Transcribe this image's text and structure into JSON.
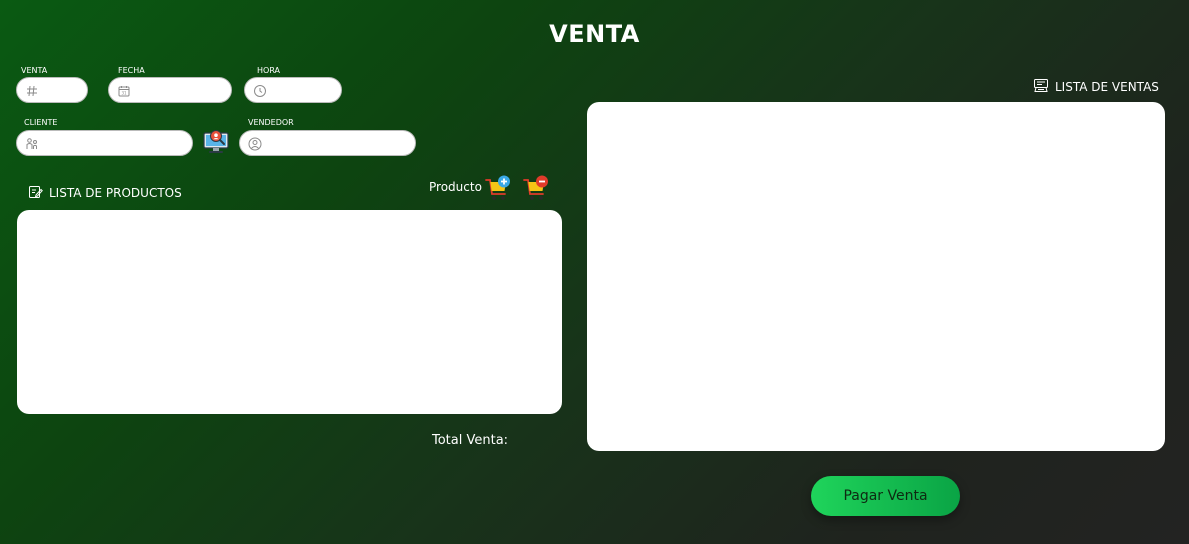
{
  "page": {
    "title": "VENTA"
  },
  "fields": {
    "venta": {
      "label": "VENTA",
      "value": ""
    },
    "fecha": {
      "label": "FECHA",
      "value": ""
    },
    "hora": {
      "label": "HORA",
      "value": ""
    },
    "cliente": {
      "label": "CLIENTE",
      "value": ""
    },
    "vendedor": {
      "label": "VENDEDOR",
      "value": ""
    }
  },
  "productos": {
    "label": "LISTA DE PRODUCTOS",
    "producto_label": "Producto"
  },
  "ventas": {
    "label": "LISTA DE VENTAS"
  },
  "total": {
    "label": "Total Venta:"
  },
  "actions": {
    "pay_label": "Pagar Venta"
  },
  "icons": {
    "venta": "hash-icon",
    "fecha": "calendar-icon",
    "hora": "clock-icon",
    "cliente": "people-icon",
    "search_client": "monitor-search-icon",
    "vendedor": "user-icon",
    "productos": "edit-list-icon",
    "ventas": "register-icon",
    "add_product": "cart-add-icon",
    "remove_product": "cart-remove-icon"
  },
  "colors": {
    "accent": "#16c653",
    "background": "#0d4410"
  }
}
